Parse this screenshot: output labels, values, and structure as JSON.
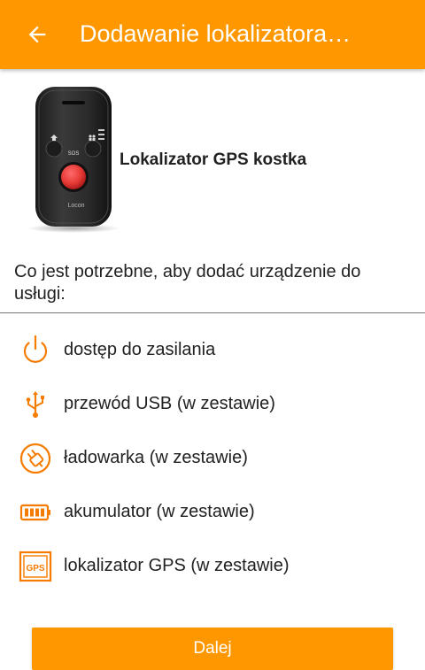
{
  "appbar": {
    "title": "Dodawanie lokalizatora…",
    "back_icon": "arrow-left",
    "background_color": "#FF9800"
  },
  "device": {
    "name": "Lokalizator GPS kostka",
    "image_text": {
      "sos": "SOS",
      "brand": "Locon"
    }
  },
  "requirements": {
    "heading": "Co jest potrzebne, aby dodać urządzenie do usługi:",
    "items": [
      {
        "icon": "power-icon",
        "label": "dostęp do zasilania"
      },
      {
        "icon": "usb-icon",
        "label": "przewód USB (w zestawie)"
      },
      {
        "icon": "charger-plug-icon",
        "label": "ładowarka (w zestawie)"
      },
      {
        "icon": "battery-icon",
        "label": "akumulator (w zestawie)"
      },
      {
        "icon": "gps-device-icon",
        "label": "lokalizator GPS (w zestawie)",
        "icon_text": "GPS"
      }
    ]
  },
  "actions": {
    "next_label": "Dalej"
  },
  "colors": {
    "accent": "#FF9800",
    "icon": "#F57C00",
    "text": "#212121"
  }
}
